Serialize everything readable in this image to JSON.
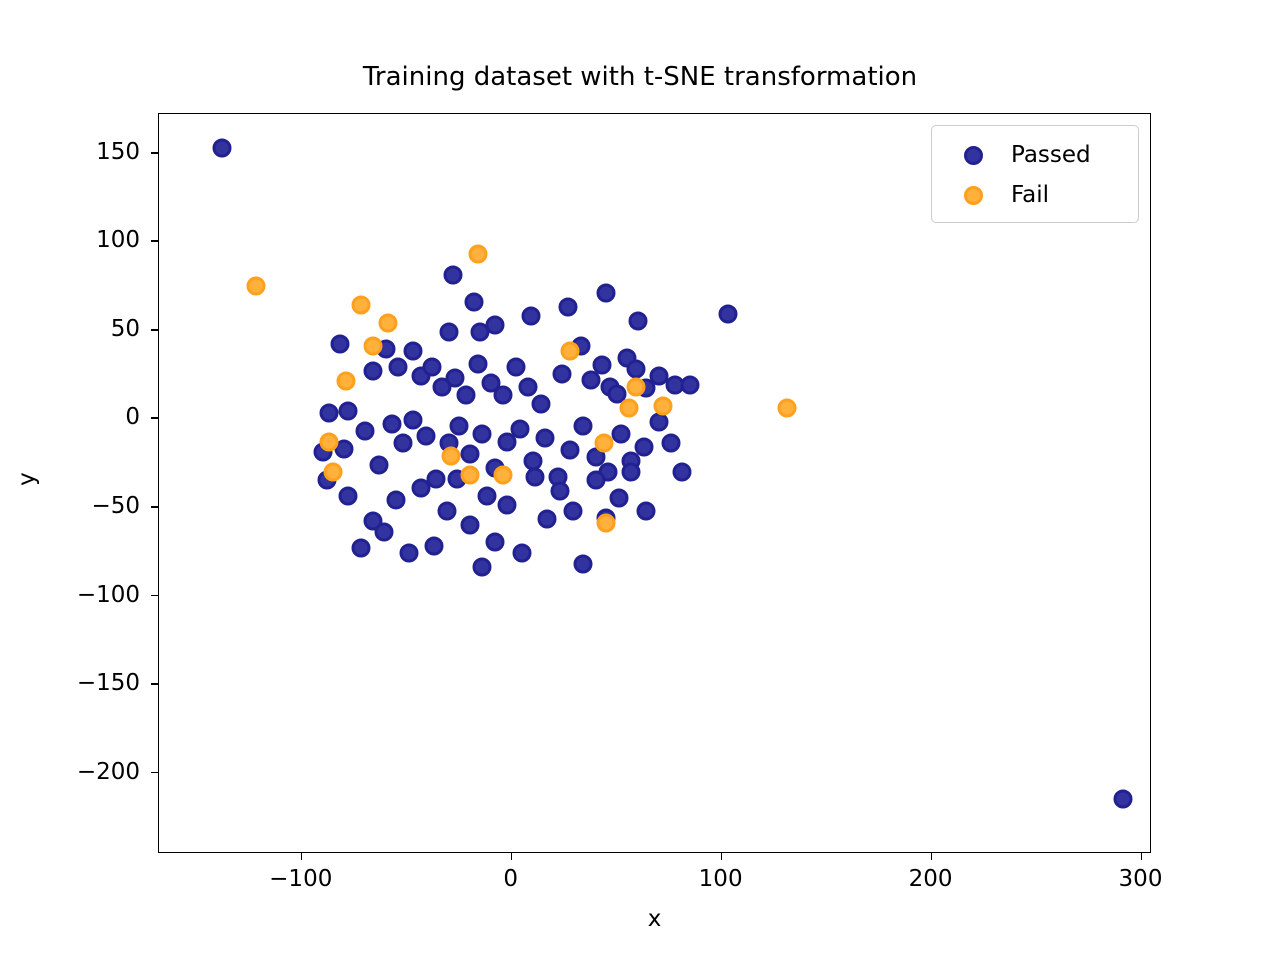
{
  "chart_data": {
    "type": "scatter",
    "title": "Training dataset with t-SNE transformation",
    "xlabel": "x",
    "ylabel": "y",
    "xlim": [
      -168,
      305
    ],
    "ylim": [
      -246,
      172
    ],
    "xticks": [
      -100,
      0,
      100,
      200,
      300
    ],
    "yticks": [
      150,
      100,
      50,
      0,
      -50,
      -100,
      -150,
      -200
    ],
    "xticklabels": [
      "−100",
      "0",
      "100",
      "200",
      "300"
    ],
    "yticklabels": [
      "150",
      "100",
      "50",
      "0",
      "−50",
      "−100",
      "−150",
      "−200"
    ],
    "grid": false,
    "legend_position": "upper right",
    "marker": "circle",
    "marker_size": 19,
    "colors": {
      "passed": "#3333a0",
      "passed_edge": "#212191",
      "fail": "#ffb13c",
      "fail_edge": "#ffa01e"
    },
    "series": [
      {
        "name": "Passed",
        "color": "#3333a0",
        "points": [
          [
            -138,
            153
          ],
          [
            -28,
            81
          ],
          [
            -82,
            42
          ],
          [
            -18,
            66
          ],
          [
            -60,
            39
          ],
          [
            -47,
            38
          ],
          [
            -30,
            49
          ],
          [
            -15,
            49
          ],
          [
            -8,
            53
          ],
          [
            9,
            58
          ],
          [
            27,
            63
          ],
          [
            45,
            71
          ],
          [
            60,
            55
          ],
          [
            103,
            59
          ],
          [
            -87,
            3
          ],
          [
            -78,
            4
          ],
          [
            -66,
            27
          ],
          [
            -54,
            29
          ],
          [
            -43,
            24
          ],
          [
            -38,
            29
          ],
          [
            -33,
            18
          ],
          [
            -27,
            23
          ],
          [
            -22,
            13
          ],
          [
            -16,
            31
          ],
          [
            -10,
            20
          ],
          [
            -4,
            13
          ],
          [
            2,
            29
          ],
          [
            8,
            18
          ],
          [
            14,
            8
          ],
          [
            24,
            25
          ],
          [
            33,
            41
          ],
          [
            38,
            22
          ],
          [
            43,
            30
          ],
          [
            47,
            18
          ],
          [
            50,
            14
          ],
          [
            55,
            34
          ],
          [
            59,
            28
          ],
          [
            64,
            17
          ],
          [
            70,
            24
          ],
          [
            78,
            19
          ],
          [
            -90,
            -19
          ],
          [
            -80,
            -17
          ],
          [
            -70,
            -7
          ],
          [
            -63,
            -26
          ],
          [
            -57,
            -3
          ],
          [
            -52,
            -14
          ],
          [
            -47,
            -1
          ],
          [
            -41,
            -10
          ],
          [
            -36,
            -34
          ],
          [
            -30,
            -14
          ],
          [
            -25,
            -4
          ],
          [
            -20,
            -20
          ],
          [
            -14,
            -9
          ],
          [
            -8,
            -28
          ],
          [
            -2,
            -13
          ],
          [
            4,
            -6
          ],
          [
            10,
            -24
          ],
          [
            16,
            -11
          ],
          [
            22,
            -33
          ],
          [
            28,
            -18
          ],
          [
            34,
            -4
          ],
          [
            40,
            -22
          ],
          [
            46,
            -30
          ],
          [
            52,
            -9
          ],
          [
            57,
            -24
          ],
          [
            63,
            -16
          ],
          [
            70,
            -2
          ],
          [
            76,
            -14
          ],
          [
            81,
            -30
          ],
          [
            85,
            19
          ],
          [
            -88,
            -35
          ],
          [
            -78,
            -44
          ],
          [
            -72,
            -73
          ],
          [
            -66,
            -58
          ],
          [
            -61,
            -64
          ],
          [
            -55,
            -46
          ],
          [
            -49,
            -76
          ],
          [
            -43,
            -39
          ],
          [
            -37,
            -72
          ],
          [
            -31,
            -52
          ],
          [
            -26,
            -34
          ],
          [
            -20,
            -60
          ],
          [
            -14,
            -84
          ],
          [
            -8,
            -70
          ],
          [
            -2,
            -49
          ],
          [
            5,
            -76
          ],
          [
            11,
            -33
          ],
          [
            17,
            -57
          ],
          [
            23,
            -41
          ],
          [
            29,
            -52
          ],
          [
            34,
            -82
          ],
          [
            40,
            -35
          ],
          [
            45,
            -56
          ],
          [
            51,
            -45
          ],
          [
            57,
            -30
          ],
          [
            64,
            -52
          ],
          [
            -12,
            -44
          ],
          [
            291,
            -215
          ]
        ]
      },
      {
        "name": "Fail",
        "color": "#ffb13c",
        "points": [
          [
            -122,
            75
          ],
          [
            -16,
            93
          ],
          [
            -72,
            64
          ],
          [
            -59,
            54
          ],
          [
            -66,
            41
          ],
          [
            -79,
            21
          ],
          [
            -87,
            -13
          ],
          [
            -85,
            -30
          ],
          [
            -29,
            -21
          ],
          [
            -20,
            -32
          ],
          [
            -4,
            -32
          ],
          [
            28,
            38
          ],
          [
            44,
            -14
          ],
          [
            59,
            18
          ],
          [
            56,
            6
          ],
          [
            72,
            7
          ],
          [
            131,
            6
          ],
          [
            45,
            -59
          ]
        ]
      }
    ]
  },
  "legend": {
    "entries": [
      {
        "label": "Passed"
      },
      {
        "label": "Fail"
      }
    ]
  }
}
